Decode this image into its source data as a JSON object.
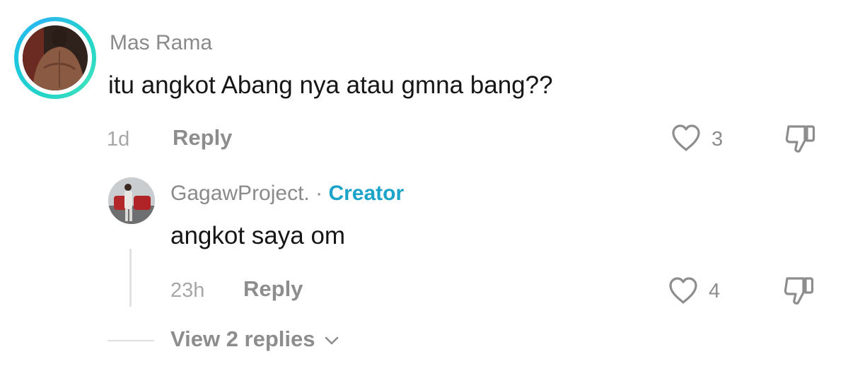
{
  "comment": {
    "username": "Mas Rama",
    "text": "itu angkot Abang nya atau gmna bang??",
    "time": "1d",
    "reply_label": "Reply",
    "like_count": "3",
    "avatar_ring_color": "#22d4c8"
  },
  "reply": {
    "username": "GagawProject.",
    "separator": "·",
    "creator_label": "Creator",
    "creator_color": "#1ca3c9",
    "text": "angkot saya om",
    "time": "23h",
    "reply_label": "Reply",
    "like_count": "4"
  },
  "view_replies": {
    "label": "View 2 replies"
  },
  "icons": {
    "like": "heart-outline-icon",
    "dislike": "thumbs-down-icon",
    "expand": "chevron-down-icon"
  }
}
